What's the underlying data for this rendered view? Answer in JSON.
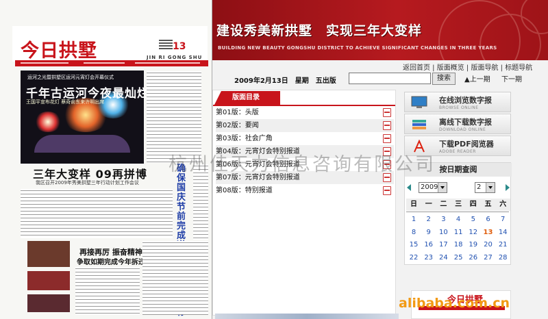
{
  "paper": {
    "logo": "今日拱墅",
    "edition_no": "13",
    "pinyin": "JIN RI GONG SHU",
    "kicker": "运河之光暨拱墅区运河元宵灯会开幕仪式",
    "headline": "千年古运河今夜最灿烂",
    "subhead": "王国平宣布花灯 蔡奇俞东来许明出席",
    "headline2": "三年大变样 09再拼博",
    "headline2_sub": "我区召开2009年秀美拱墅三年行动计划工作会议",
    "vertical_head": "确保国庆节前完成道路建设整治目标",
    "headline3a": "再接再厉 振奋精神",
    "headline3b": "争取如期完成今年拆迁任务"
  },
  "banner": {
    "title": "建设秀美新拱墅　实现三年大变样",
    "subtitle": "BUILDING NEW BEAUTY GONGSHU DISTRICT   TO ACHIEVE SIGNIFICANT CHANGES IN THREE YEARS"
  },
  "nav": {
    "items": [
      "返回首页",
      "版面概览",
      "版面导航",
      "标题导航"
    ]
  },
  "datebar": {
    "date": "2009年2月13日　星期　五出版",
    "search_value": "",
    "search_button": "搜索",
    "prev": "上一期",
    "next": "下一期"
  },
  "toc": {
    "title": "版面目录",
    "rows": [
      "第01版：头版",
      "第02版：要闻",
      "第03版：社会广角",
      "第04版：元宵灯会特别报道",
      "第06版：元宵灯会特别报道",
      "第07版：元宵灯会特别报道",
      "第08版：特别报道"
    ]
  },
  "side": {
    "btn1": "在线浏览数字报",
    "btn1_en": "BROWSE ONLINE",
    "btn2": "离线下载数字报",
    "btn2_en": "DOWNLOAD ONLINE",
    "btn3": "下载PDF阅览器",
    "btn3_en": "ADOBE READER"
  },
  "calendar": {
    "title": "按日期查阅",
    "year": "2009",
    "month": "2",
    "weekdays": [
      "日",
      "一",
      "二",
      "三",
      "四",
      "五",
      "六"
    ],
    "days": [
      "1",
      "2",
      "3",
      "4",
      "5",
      "6",
      "7",
      "8",
      "9",
      "10",
      "11",
      "12",
      "13",
      "14",
      "15",
      "16",
      "17",
      "18",
      "19",
      "20",
      "21",
      "22",
      "23",
      "24",
      "25",
      "26",
      "27",
      "28"
    ],
    "highlight_day": "13"
  },
  "thumb_logo": "今日拱墅",
  "watermark": "杭州佳天力信息咨询有限公司",
  "alibaba": "alibaba.com.cn",
  "colors": {
    "brand_red": "#c8141b",
    "banner_dark": "#8d0f14",
    "link_blue": "#1e4fb0"
  }
}
